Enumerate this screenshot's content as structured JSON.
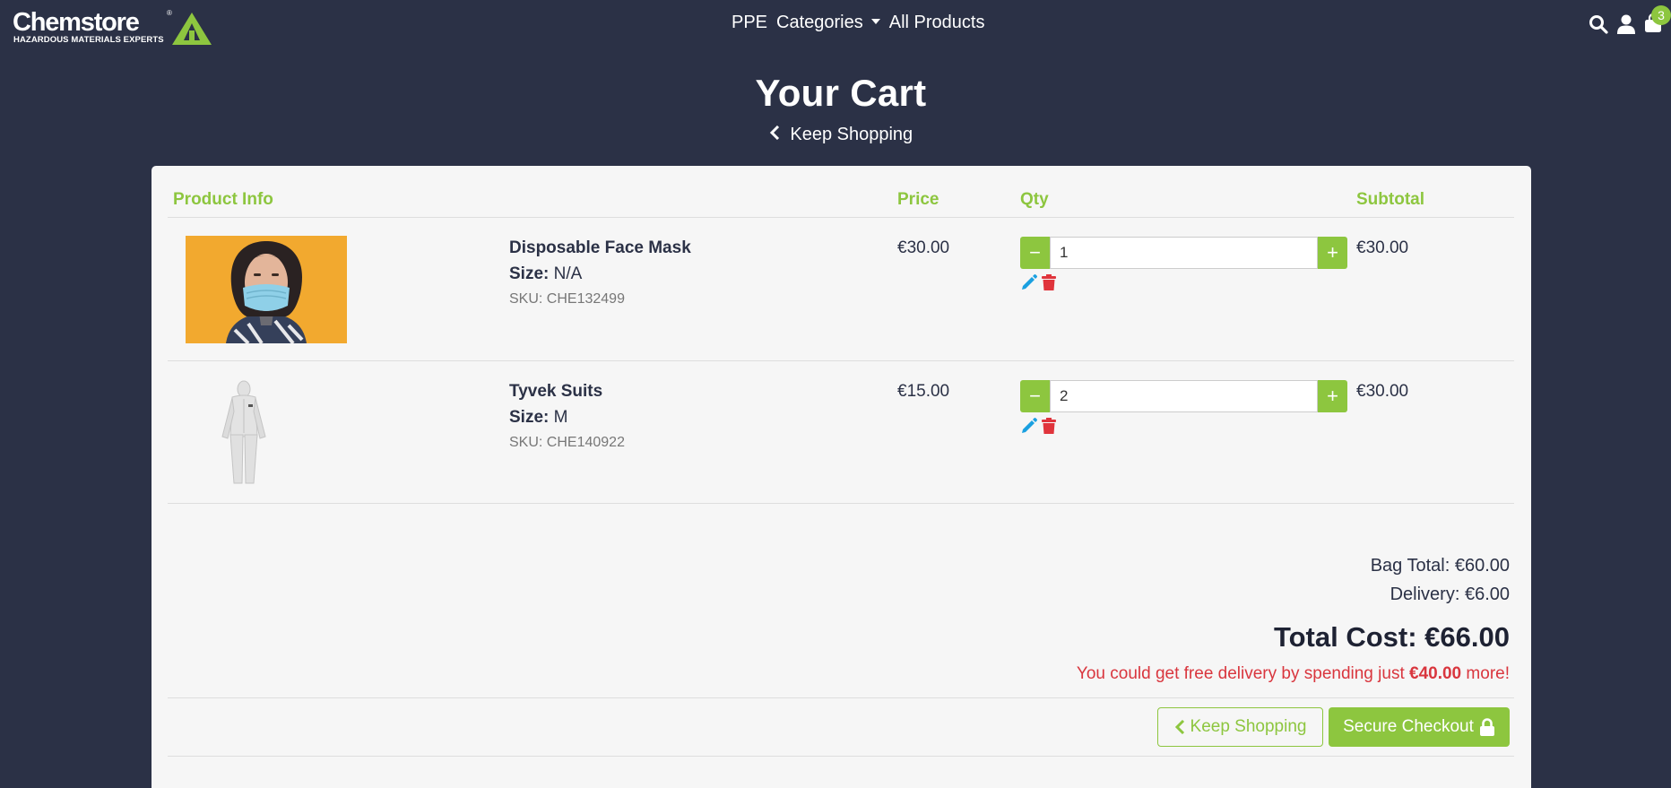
{
  "brand": {
    "name": "Chemstore",
    "registered": "®",
    "tagline": "HAZARDOUS MATERIALS EXPERTS",
    "accent": "#8dc63f",
    "nav_bg": "#2b3146"
  },
  "nav": {
    "links": [
      "PPE",
      "Categories",
      "All Products"
    ],
    "icons": [
      "search-icon",
      "user-icon",
      "shopping-bag-icon"
    ],
    "cart_count": "3"
  },
  "page": {
    "title": "Your Cart",
    "keep_shopping": "Keep Shopping"
  },
  "table": {
    "headers": {
      "product_info": "Product Info",
      "price": "Price",
      "qty": "Qty",
      "subtotal": "Subtotal"
    },
    "items": [
      {
        "name": "Disposable Face Mask",
        "size_label": "Size:",
        "size": "N/A",
        "sku": "SKU: CHE132499",
        "price": "€30.00",
        "qty": "1",
        "subtotal": "€30.00",
        "image": "face-mask-photo"
      },
      {
        "name": "Tyvek Suits",
        "size_label": "Size:",
        "size": "M",
        "sku": "SKU: CHE140922",
        "price": "€15.00",
        "qty": "2",
        "subtotal": "€30.00",
        "image": "tyvek-suit-photo"
      }
    ]
  },
  "totals": {
    "bag_total": "Bag Total: €60.00",
    "delivery": "Delivery: €6.00",
    "total_cost": "Total Cost: €66.00",
    "free_delivery_prefix": "You could get free delivery by spending just",
    "free_delivery_amount": "€40.00",
    "free_delivery_suffix": "more!"
  },
  "actions": {
    "keep_shopping": "Keep Shopping",
    "checkout": "Secure Checkout"
  }
}
